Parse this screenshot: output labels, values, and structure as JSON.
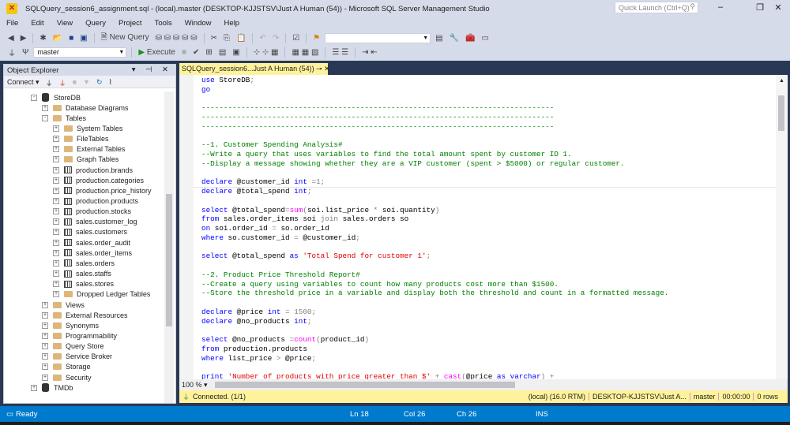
{
  "window": {
    "title": "SQLQuery_session6_assignment.sql - (local).master (DESKTOP-KJJSTSV\\Just A Human (54)) - Microsoft SQL Server Management Studio",
    "quick_launch_placeholder": "Quick Launch (Ctrl+Q)"
  },
  "menu": [
    "File",
    "Edit",
    "View",
    "Query",
    "Project",
    "Tools",
    "Window",
    "Help"
  ],
  "toolbar": {
    "new_query": "New Query",
    "database": "master",
    "execute": "Execute"
  },
  "object_explorer": {
    "title": "Object Explorer",
    "connect": "Connect",
    "nodes": [
      {
        "label": "StoreDB",
        "level": 0,
        "type": "db",
        "exp": "-"
      },
      {
        "label": "Database Diagrams",
        "level": 1,
        "type": "folder",
        "exp": "+"
      },
      {
        "label": "Tables",
        "level": 1,
        "type": "folder",
        "exp": "-"
      },
      {
        "label": "System Tables",
        "level": 2,
        "type": "folder",
        "exp": "+"
      },
      {
        "label": "FileTables",
        "level": 2,
        "type": "folder",
        "exp": "+"
      },
      {
        "label": "External Tables",
        "level": 2,
        "type": "folder",
        "exp": "+"
      },
      {
        "label": "Graph Tables",
        "level": 2,
        "type": "folder",
        "exp": "+"
      },
      {
        "label": "production.brands",
        "level": 2,
        "type": "table",
        "exp": "+"
      },
      {
        "label": "production.categories",
        "level": 2,
        "type": "table",
        "exp": "+"
      },
      {
        "label": "production.price_history",
        "level": 2,
        "type": "table",
        "exp": "+"
      },
      {
        "label": "production.products",
        "level": 2,
        "type": "table",
        "exp": "+"
      },
      {
        "label": "production.stocks",
        "level": 2,
        "type": "table",
        "exp": "+"
      },
      {
        "label": "sales.customer_log",
        "level": 2,
        "type": "table",
        "exp": "+"
      },
      {
        "label": "sales.customers",
        "level": 2,
        "type": "table",
        "exp": "+"
      },
      {
        "label": "sales.order_audit",
        "level": 2,
        "type": "table",
        "exp": "+"
      },
      {
        "label": "sales.order_items",
        "level": 2,
        "type": "table",
        "exp": "+"
      },
      {
        "label": "sales.orders",
        "level": 2,
        "type": "table",
        "exp": "+"
      },
      {
        "label": "sales.staffs",
        "level": 2,
        "type": "table",
        "exp": "+"
      },
      {
        "label": "sales.stores",
        "level": 2,
        "type": "table",
        "exp": "+"
      },
      {
        "label": "Dropped Ledger Tables",
        "level": 2,
        "type": "folder",
        "exp": "+"
      },
      {
        "label": "Views",
        "level": 1,
        "type": "folder",
        "exp": "+"
      },
      {
        "label": "External Resources",
        "level": 1,
        "type": "folder",
        "exp": "+"
      },
      {
        "label": "Synonyms",
        "level": 1,
        "type": "folder",
        "exp": "+"
      },
      {
        "label": "Programmability",
        "level": 1,
        "type": "folder",
        "exp": "+"
      },
      {
        "label": "Query Store",
        "level": 1,
        "type": "folder",
        "exp": "+"
      },
      {
        "label": "Service Broker",
        "level": 1,
        "type": "folder",
        "exp": "+"
      },
      {
        "label": "Storage",
        "level": 1,
        "type": "folder",
        "exp": "+"
      },
      {
        "label": "Security",
        "level": 1,
        "type": "folder",
        "exp": "+"
      },
      {
        "label": "TMDb",
        "level": 0,
        "type": "db",
        "exp": "+"
      }
    ]
  },
  "editor_tab": {
    "label": "SQLQuery_session6...Just A Human (54))"
  },
  "code": [
    [
      [
        "use ",
        "k"
      ],
      [
        "StoreDB",
        "t"
      ],
      [
        ";",
        "g"
      ]
    ],
    [
      [
        "go",
        "k"
      ]
    ],
    [],
    [
      [
        "--------------------------------------------------------------------------------",
        "c"
      ]
    ],
    [
      [
        "--------------------------------------------------------------------------------",
        "c"
      ]
    ],
    [
      [
        "--------------------------------------------------------------------------------",
        "c"
      ]
    ],
    [],
    [
      [
        "--1. Customer Spending Analysis#",
        "c"
      ]
    ],
    [
      [
        "--Write a query that uses variables to find the total amount spent by customer ID 1.",
        "c"
      ]
    ],
    [
      [
        "--Display a message showing whether they are a VIP customer (spent > $5000) or regular customer.",
        "c"
      ]
    ],
    [],
    [
      [
        "declare ",
        "k"
      ],
      [
        "@customer_id ",
        "t"
      ],
      [
        "int ",
        "k"
      ],
      [
        "=1;",
        "g"
      ]
    ],
    [
      [
        "declare ",
        "k"
      ],
      [
        "@total_spend ",
        "t"
      ],
      [
        "int",
        "k"
      ],
      [
        ";",
        "g"
      ]
    ],
    [],
    [
      [
        "select ",
        "k"
      ],
      [
        "@total_spend",
        "t"
      ],
      [
        "=",
        "g"
      ],
      [
        "sum",
        "f"
      ],
      [
        "(",
        "g"
      ],
      [
        "soi.list_price ",
        "t"
      ],
      [
        "* ",
        "g"
      ],
      [
        "soi.quantity",
        "t"
      ],
      [
        ")",
        "g"
      ]
    ],
    [
      [
        "from ",
        "k"
      ],
      [
        "sales.order_items soi ",
        "t"
      ],
      [
        "join ",
        "g"
      ],
      [
        "sales.orders so",
        "t"
      ]
    ],
    [
      [
        "on ",
        "k"
      ],
      [
        "soi.order_id ",
        "t"
      ],
      [
        "= ",
        "g"
      ],
      [
        "so.order_id",
        "t"
      ]
    ],
    [
      [
        "where ",
        "k"
      ],
      [
        "so.customer_id ",
        "t"
      ],
      [
        "= ",
        "g"
      ],
      [
        "@customer_id",
        "t"
      ],
      [
        ";",
        "g"
      ]
    ],
    [],
    [
      [
        "select ",
        "k"
      ],
      [
        "@total_spend ",
        "t"
      ],
      [
        "as ",
        "k"
      ],
      [
        "'Total Spend for customer 1'",
        "s"
      ],
      [
        ";",
        "g"
      ]
    ],
    [],
    [
      [
        "--2. Product Price Threshold Report#",
        "c"
      ]
    ],
    [
      [
        "--Create a query using variables to count how many products cost more than $1500.",
        "c"
      ]
    ],
    [
      [
        "--Store the threshold price in a variable and display both the threshold and count in a formatted message.",
        "c"
      ]
    ],
    [],
    [
      [
        "declare ",
        "k"
      ],
      [
        "@price ",
        "t"
      ],
      [
        "int ",
        "k"
      ],
      [
        "= 1500;",
        "g"
      ]
    ],
    [
      [
        "declare ",
        "k"
      ],
      [
        "@no_products ",
        "t"
      ],
      [
        "int",
        "k"
      ],
      [
        ";",
        "g"
      ]
    ],
    [],
    [
      [
        "select ",
        "k"
      ],
      [
        "@no_products ",
        "t"
      ],
      [
        "=",
        "g"
      ],
      [
        "count",
        "f"
      ],
      [
        "(",
        "g"
      ],
      [
        "product_id",
        "t"
      ],
      [
        ")",
        "g"
      ]
    ],
    [
      [
        "from ",
        "k"
      ],
      [
        "production.products",
        "t"
      ]
    ],
    [
      [
        "where ",
        "k"
      ],
      [
        "list_price ",
        "t"
      ],
      [
        "> ",
        "g"
      ],
      [
        "@price",
        "t"
      ],
      [
        ";",
        "g"
      ]
    ],
    [],
    [
      [
        "print ",
        "k"
      ],
      [
        "'Number of products with price greater than $' ",
        "s"
      ],
      [
        "+ ",
        "g"
      ],
      [
        "cast",
        "f"
      ],
      [
        "(",
        "g"
      ],
      [
        "@price ",
        "t"
      ],
      [
        "as ",
        "k"
      ],
      [
        "varchar",
        "k"
      ],
      [
        ") +",
        "g"
      ]
    ]
  ],
  "zoom": "100 %",
  "connection_status": {
    "message": "Connected. (1/1)",
    "server": "(local) (16.0 RTM)",
    "user": "DESKTOP-KJJSTSV\\Just A...",
    "database": "master",
    "elapsed": "00:00:00",
    "rows": "0 rows"
  },
  "statusbar": {
    "ready": "Ready",
    "ln": "Ln 18",
    "col": "Col 26",
    "ch": "Ch 26",
    "mode": "INS"
  }
}
